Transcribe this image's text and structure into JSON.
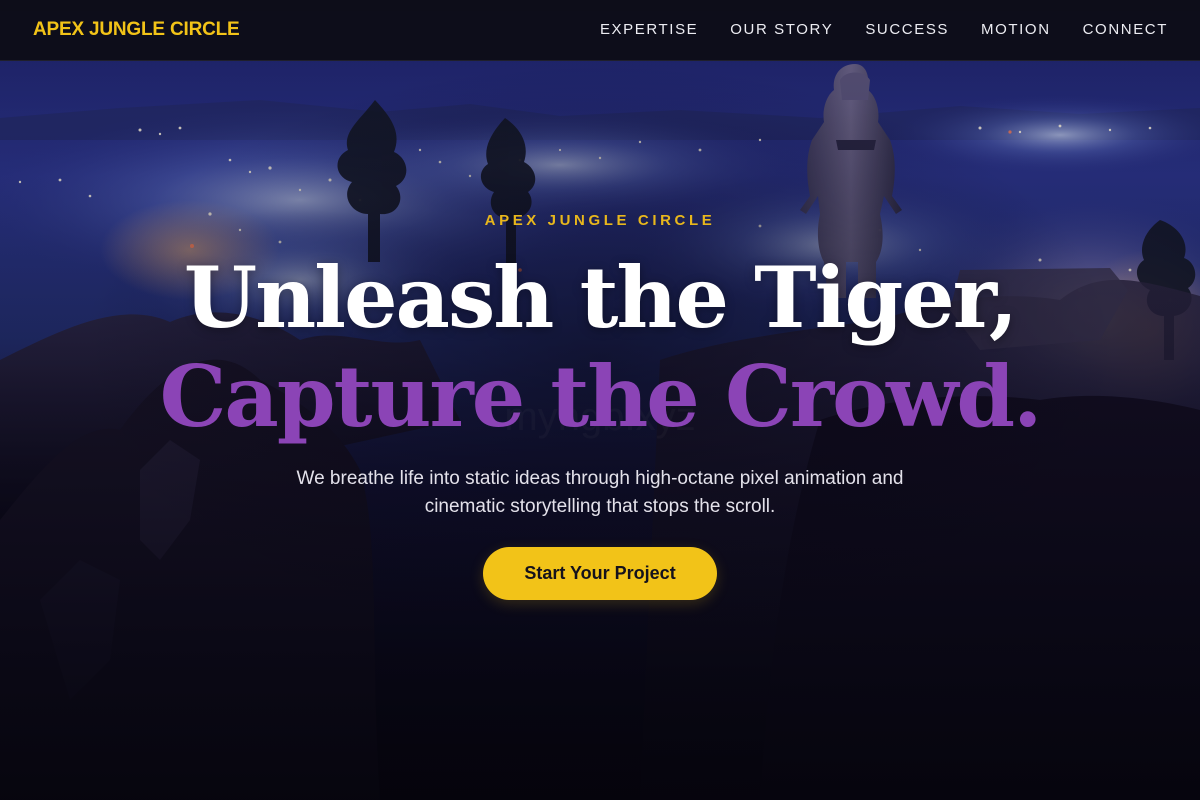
{
  "nav": {
    "brand": "APEX JUNGLE CIRCLE",
    "links": [
      "EXPERTISE",
      "OUR STORY",
      "SUCCESS",
      "MOTION",
      "CONNECT"
    ]
  },
  "hero": {
    "eyebrow": "APEX JUNGLE CIRCLE",
    "headline_line1": "Unleash the Tiger,",
    "headline_line2": "Capture the Crowd.",
    "subtitle": "We breathe life into static ideas through high-octane pixel animation and cinematic storytelling that stops the scroll.",
    "cta_label": "Start Your Project"
  },
  "colors": {
    "accent_yellow": "#f2c318",
    "accent_purple": "#8b44b6",
    "nav_background": "#0c0c14"
  }
}
